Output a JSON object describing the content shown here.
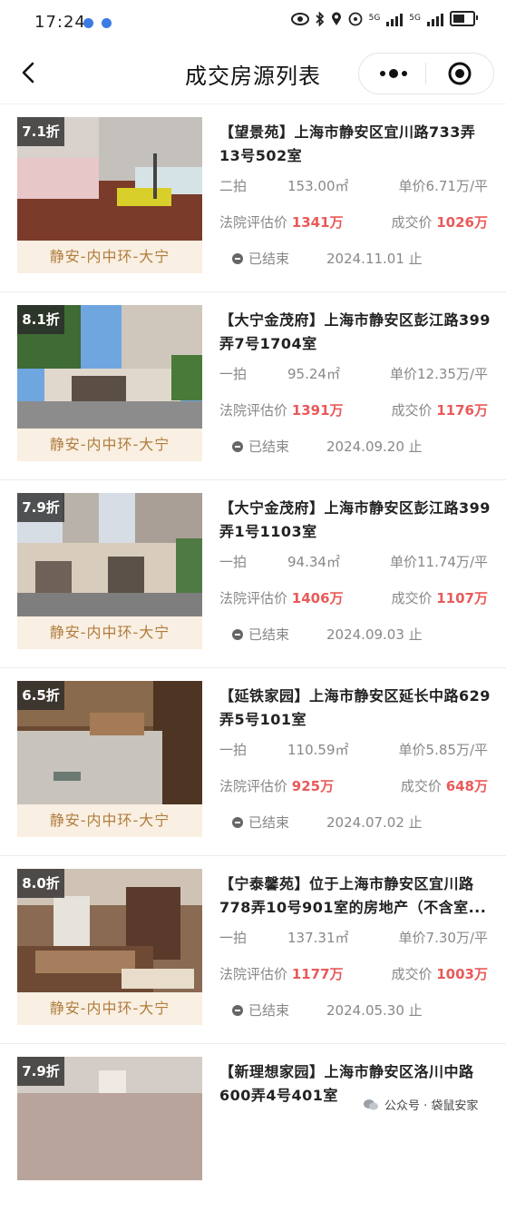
{
  "status_bar": {
    "time": "17:24",
    "net1": "5G",
    "net2": "5G"
  },
  "nav": {
    "title": "成交房源列表"
  },
  "listings": [
    {
      "discount": "7.1折",
      "area": "静安-内中环-大宁",
      "title": "【望景苑】上海市静安区宜川路733弄13号502室",
      "round": "二拍",
      "size": "153.00㎡",
      "unit_price": "单价6.71万/平",
      "eval_label": "法院评估价",
      "eval_price": "1341万",
      "deal_label": "成交价",
      "deal_price": "1026万",
      "status": "已结束",
      "date": "2024.11.01 止"
    },
    {
      "discount": "8.1折",
      "area": "静安-内中环-大宁",
      "title": "【大宁金茂府】上海市静安区彭江路399弄7号1704室",
      "round": "一拍",
      "size": "95.24㎡",
      "unit_price": "单价12.35万/平",
      "eval_label": "法院评估价",
      "eval_price": "1391万",
      "deal_label": "成交价",
      "deal_price": "1176万",
      "status": "已结束",
      "date": "2024.09.20 止"
    },
    {
      "discount": "7.9折",
      "area": "静安-内中环-大宁",
      "title": "【大宁金茂府】上海市静安区彭江路399弄1号1103室",
      "round": "一拍",
      "size": "94.34㎡",
      "unit_price": "单价11.74万/平",
      "eval_label": "法院评估价",
      "eval_price": "1406万",
      "deal_label": "成交价",
      "deal_price": "1107万",
      "status": "已结束",
      "date": "2024.09.03 止"
    },
    {
      "discount": "6.5折",
      "area": "静安-内中环-大宁",
      "title": "【延铁家园】上海市静安区延长中路629弄5号101室",
      "round": "一拍",
      "size": "110.59㎡",
      "unit_price": "单价5.85万/平",
      "eval_label": "法院评估价",
      "eval_price": "925万",
      "deal_label": "成交价",
      "deal_price": "648万",
      "status": "已结束",
      "date": "2024.07.02 止"
    },
    {
      "discount": "8.0折",
      "area": "静安-内中环-大宁",
      "title": "【宁泰馨苑】位于上海市静安区宜川路778弄10号901室的房地产（不含室...",
      "round": "一拍",
      "size": "137.31㎡",
      "unit_price": "单价7.30万/平",
      "eval_label": "法院评估价",
      "eval_price": "1177万",
      "deal_label": "成交价",
      "deal_price": "1003万",
      "status": "已结束",
      "date": "2024.05.30 止"
    },
    {
      "discount": "7.9折",
      "area": "",
      "title": "【新理想家园】上海市静安区洛川中路600弄4号401室",
      "round": "",
      "size": "",
      "unit_price": "",
      "eval_label": "",
      "eval_price": "",
      "deal_label": "",
      "deal_price": "",
      "status": "",
      "date": ""
    }
  ],
  "watermark": {
    "text": "公众号 · 袋鼠安家"
  }
}
